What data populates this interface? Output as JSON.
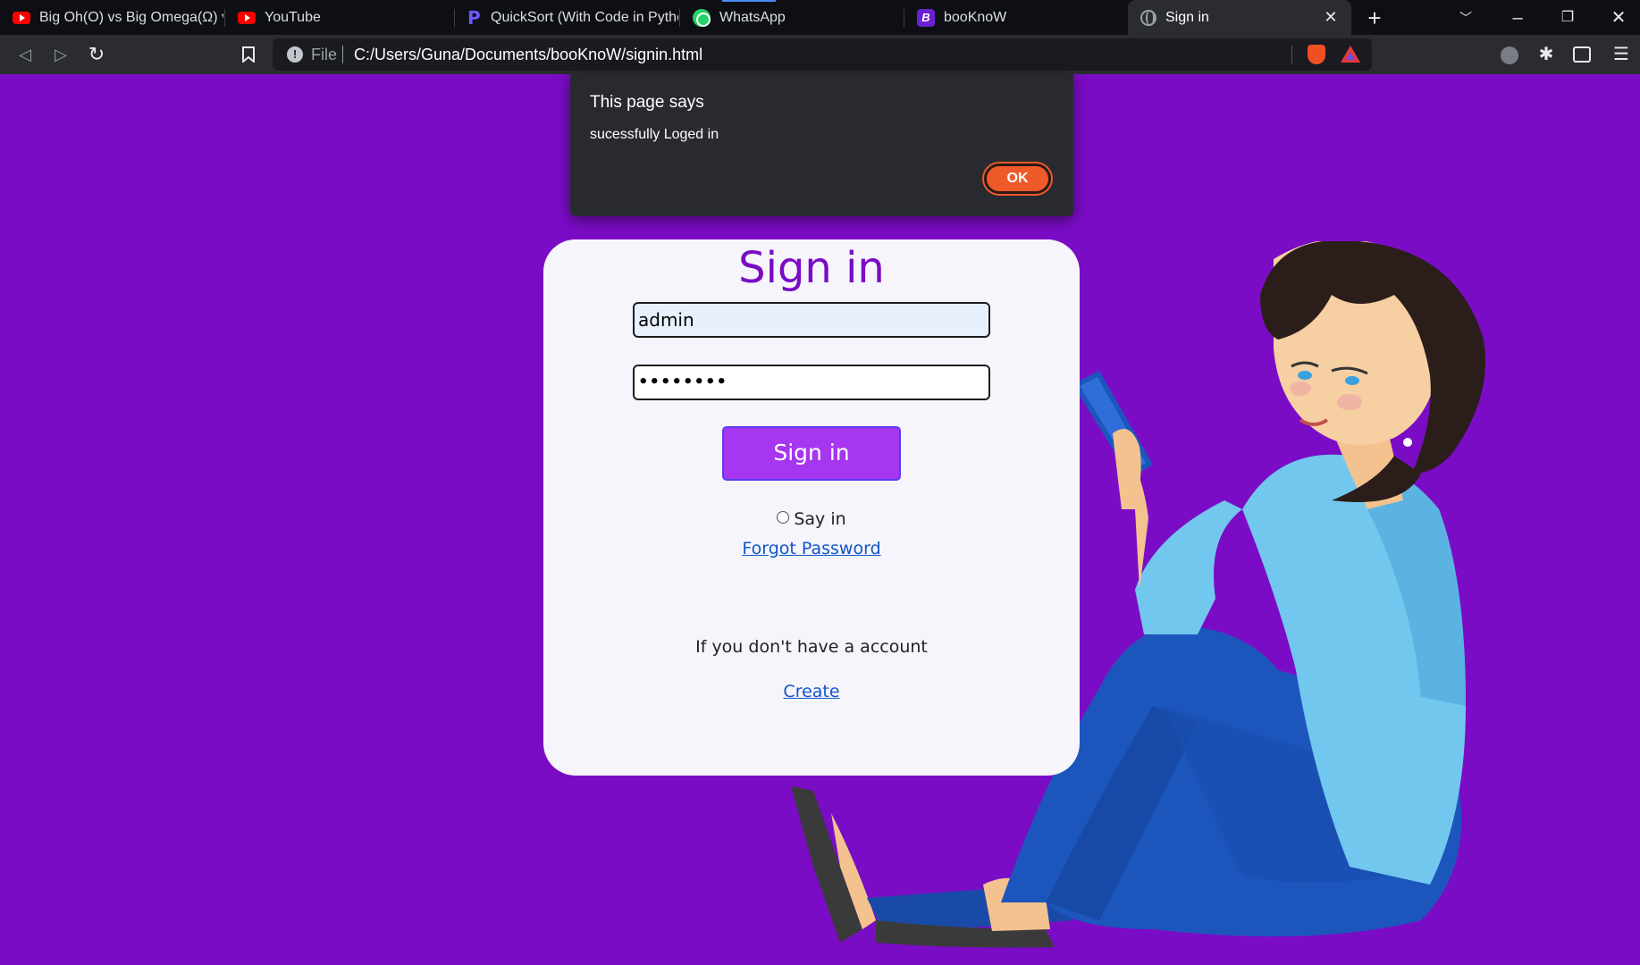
{
  "browser": {
    "tabs": [
      {
        "title": "Big Oh(O) vs Big Omega(Ω) vs",
        "icon": "youtube-icon"
      },
      {
        "title": "YouTube",
        "icon": "youtube-icon"
      },
      {
        "title": "QuickSort (With Code in Pytho",
        "icon": "programiz-icon"
      },
      {
        "title": "WhatsApp",
        "icon": "whatsapp-icon"
      },
      {
        "title": "booKnoW",
        "icon": "booknow-icon"
      },
      {
        "title": "Sign in",
        "icon": "globe-icon",
        "active": true
      }
    ],
    "address": {
      "scheme_label": "File",
      "url": "C:/Users/Guna/Documents/booKnoW/signin.html"
    }
  },
  "alert": {
    "title": "This page says",
    "message": "sucessfully Loged in",
    "ok_label": "OK"
  },
  "signin": {
    "title": "Sign in",
    "username_value": "admin",
    "password_value": "••••••••",
    "button_label": "Sign in",
    "remember_label": "Say in",
    "forgot_label": "Forgot Password",
    "no_account_text": "If you don't have a account",
    "create_label": "Create"
  },
  "colors": {
    "page_background": "#7b0cc6",
    "title": "#7a0cc4",
    "button": "#a736f0",
    "alert_ok": "#ef5a2a"
  }
}
